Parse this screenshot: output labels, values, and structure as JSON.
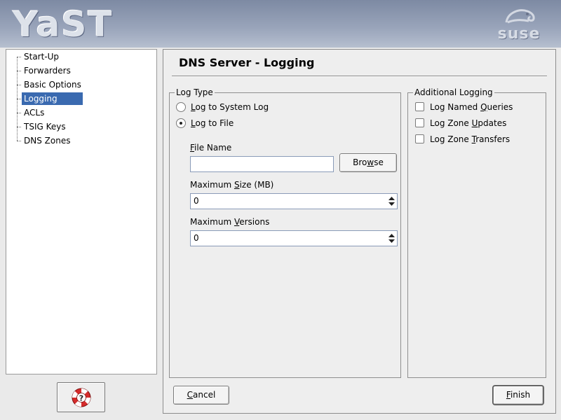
{
  "branding": {
    "app_logo_text": "YaST",
    "vendor_logo_text": "suse"
  },
  "tree": {
    "items": [
      {
        "label": "Start-Up",
        "selected": false
      },
      {
        "label": "Forwarders",
        "selected": false
      },
      {
        "label": "Basic Options",
        "selected": false
      },
      {
        "label": "Logging",
        "selected": true
      },
      {
        "label": "ACLs",
        "selected": false
      },
      {
        "label": "TSIG Keys",
        "selected": false
      },
      {
        "label": "DNS Zones",
        "selected": false
      }
    ]
  },
  "help": {
    "icon": "help-lifebuoy-icon"
  },
  "dialog": {
    "title": "DNS Server - Logging",
    "log_type": {
      "legend": "Log Type",
      "system_log": {
        "pre": "",
        "key": "L",
        "post": "og to System Log",
        "checked": false
      },
      "log_to_file": {
        "pre": "",
        "key": "L",
        "post": "og to File",
        "checked": true
      },
      "file_name": {
        "pre": "",
        "key": "F",
        "post": "ile Name",
        "value": ""
      },
      "browse": {
        "pre": "Bro",
        "key": "w",
        "post": "se"
      },
      "max_size": {
        "pre": "Maximum ",
        "key": "S",
        "post": "ize (MB)",
        "value": "0"
      },
      "max_versions": {
        "pre": "Maximum ",
        "key": "V",
        "post": "ersions",
        "value": "0"
      }
    },
    "additional": {
      "legend": "Additional Logging",
      "named_queries": {
        "pre": "Log Named ",
        "key": "Q",
        "post": "ueries",
        "checked": false
      },
      "zone_updates": {
        "pre": "Log Zone ",
        "key": "U",
        "post": "pdates",
        "checked": false
      },
      "zone_transfers": {
        "pre": "Log Zone ",
        "key": "T",
        "post": "ransfers",
        "checked": false
      }
    },
    "cancel": {
      "pre": "",
      "key": "C",
      "post": "ancel"
    },
    "finish": {
      "pre": "",
      "key": "F",
      "post": "inish"
    }
  },
  "colors": {
    "selection": "#3a6ab0",
    "banner": "#8f9ab2"
  }
}
